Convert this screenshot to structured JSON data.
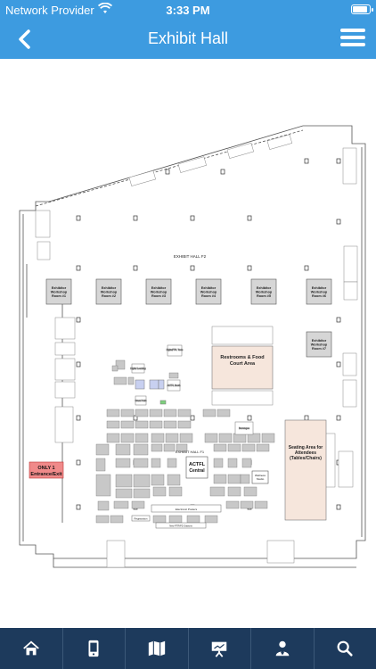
{
  "status_bar": {
    "carrier": "Network Provider",
    "time": "3:33 PM",
    "battery_level": 0.95
  },
  "nav": {
    "title": "Exhibit Hall",
    "back_icon": "chevron-left-icon",
    "menu_icon": "hamburger-menu-icon"
  },
  "map": {
    "hall_f2_label": "EXHIBIT HALL F2",
    "hall_f1_label": "EXHIBIT HALL F1",
    "workshop_line1": "Exhibitor",
    "workshop_line2": "Workshop",
    "workshops": [
      {
        "room": "Room #1"
      },
      {
        "room": "Room #2"
      },
      {
        "room": "Room #3"
      },
      {
        "room": "Room #4"
      },
      {
        "room": "Room #5"
      },
      {
        "room": "Room #6"
      },
      {
        "room": "Room #7"
      }
    ],
    "restrooms_line1": "Restrooms & Food",
    "restrooms_line2": "Court Area",
    "seating_line1": "Seating Area for",
    "seating_line2": "Attendees",
    "seating_line3": "(Tables/Chairs)",
    "entrance_line1": "ONLY 1",
    "entrance_line2": "Entrance/Exit",
    "actfl_line1": "ACTFL",
    "actfl_line2": "Central",
    "wellness_line1": "Wellness",
    "wellness_line2": "Studio",
    "beverages": "Beverages",
    "tech_tools": "Digital/TPL Tools",
    "digital_learning": "Digital Learning",
    "actfl_booth": "ACTFL Booth",
    "grand_cafe": "Grand Cafe",
    "posters": "Electronic Posters",
    "registration": "Registration",
    "new_ptr": "New PTR/PD Stations",
    "colors": {
      "accent": "#3d9be0",
      "tab_bar": "#1d3a5c",
      "entrance": "#f08a8a",
      "restrooms": "#f6e6dc",
      "booth_gray": "#c8c8c8"
    }
  },
  "tabs": [
    {
      "name": "home-icon"
    },
    {
      "name": "mobile-device-icon"
    },
    {
      "name": "folded-map-icon"
    },
    {
      "name": "presentation-easel-icon"
    },
    {
      "name": "person-badge-icon"
    },
    {
      "name": "search-icon"
    }
  ]
}
